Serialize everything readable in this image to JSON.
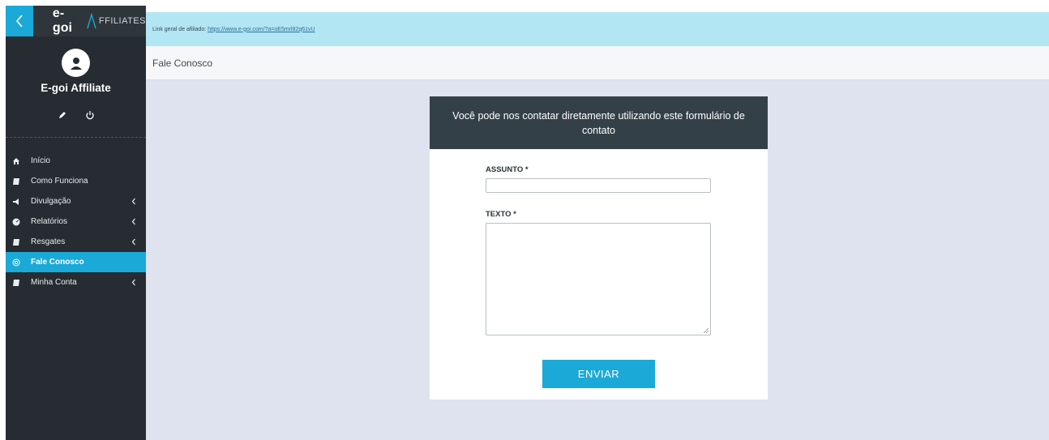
{
  "brand": {
    "main": "e-goi",
    "sub": "FFILIATES"
  },
  "profile": {
    "name": "E-goi Affiliate"
  },
  "menu": {
    "items": [
      {
        "label": "Início"
      },
      {
        "label": "Como Funciona"
      },
      {
        "label": "Divulgação"
      },
      {
        "label": "Relatórios"
      },
      {
        "label": "Resgates"
      },
      {
        "label": "Fale Conosco"
      },
      {
        "label": "Minha Conta"
      }
    ]
  },
  "linkbar": {
    "label": "Link geral de afiliado:",
    "url": "https://www.e-goi.com/?a=oE5mrl82q61vU"
  },
  "page": {
    "title": "Fale Conosco"
  },
  "form": {
    "heading": "Você pode nos contatar diretamente utilizando este formulário de contato",
    "subject_label": "ASSUNTO *",
    "subject_value": "",
    "text_label": "TEXTO *",
    "text_value": "",
    "submit_label": "ENVIAR"
  },
  "colors": {
    "accent": "#1ba9d8",
    "sidebar": "#262c31",
    "card_header": "#344048",
    "linkbar": "#b2e6f3",
    "content_bg": "#dfe3ef"
  }
}
